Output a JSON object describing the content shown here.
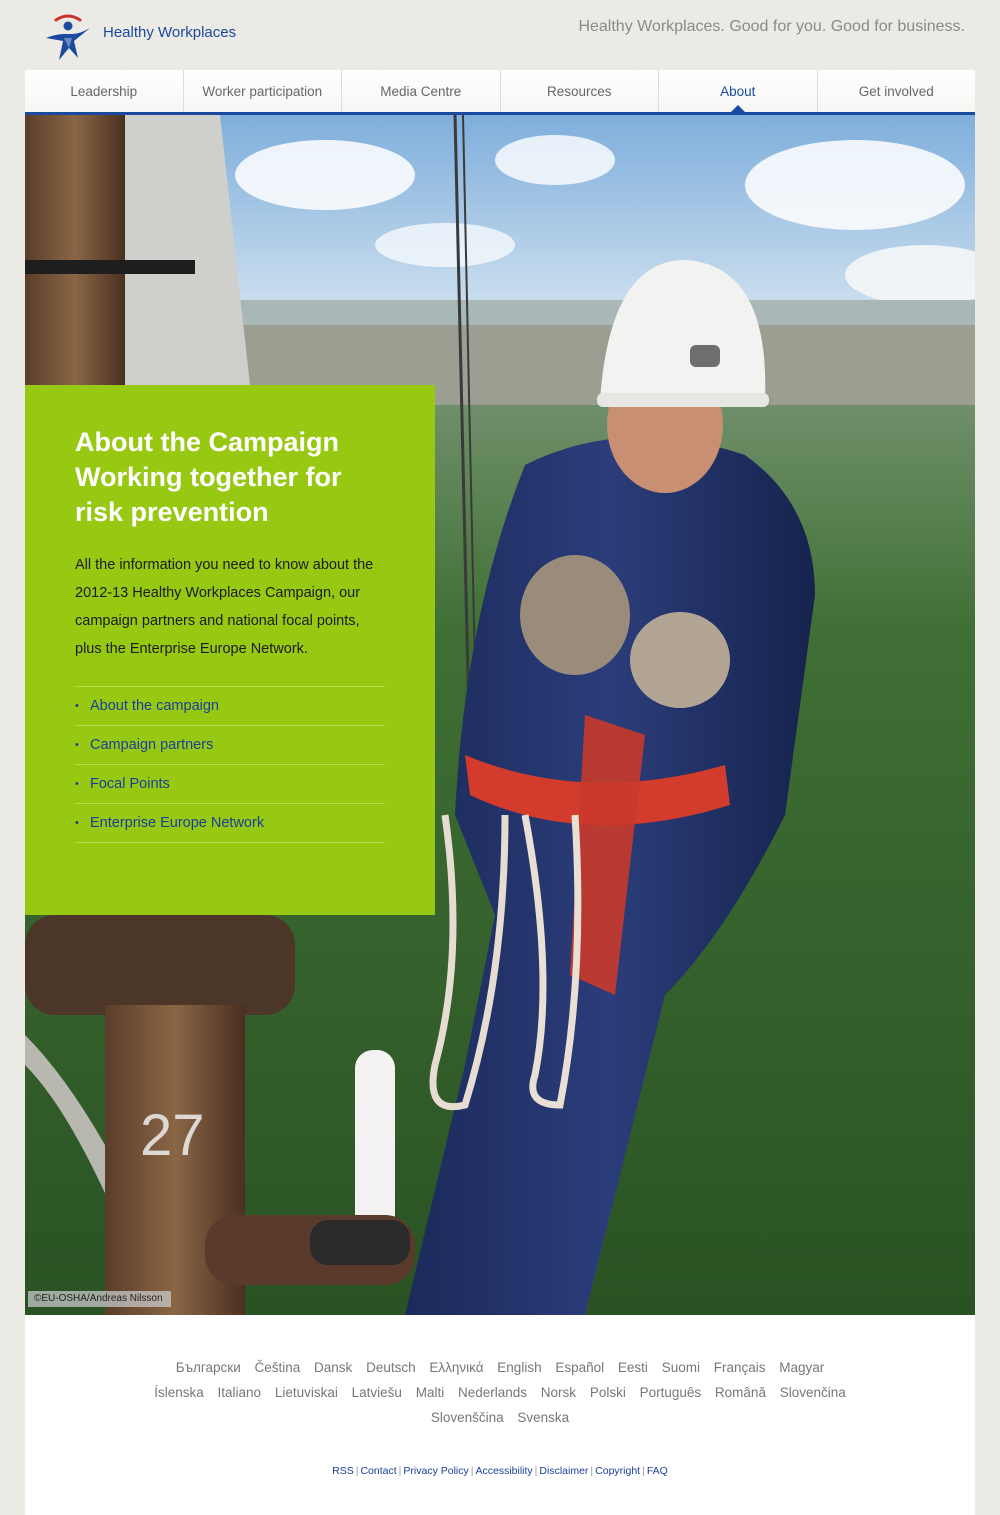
{
  "header": {
    "site_name": "Healthy Workplaces",
    "tagline": "Healthy Workplaces. Good for you. Good for business."
  },
  "nav": {
    "items": [
      {
        "label": "Leadership"
      },
      {
        "label": "Worker participation"
      },
      {
        "label": "Media Centre"
      },
      {
        "label": "Resources"
      },
      {
        "label": "About"
      },
      {
        "label": "Get involved"
      }
    ],
    "active": "About"
  },
  "hero": {
    "photo_credit": "©EU-OSHA/Andreas Nilsson"
  },
  "panel": {
    "title_line1": "About the Campaign",
    "title_line2": "Working together for",
    "title_line3": "risk prevention",
    "description": "All the information you need to know about the 2012-13 Healthy Workplaces Campaign, our campaign partners and national focal points, plus the Enterprise Europe Network.",
    "links": [
      {
        "label": "About the campaign"
      },
      {
        "label": "Campaign partners"
      },
      {
        "label": "Focal Points"
      },
      {
        "label": "Enterprise Europe Network"
      }
    ]
  },
  "footer": {
    "languages": [
      "Български",
      "Čeština",
      "Dansk",
      "Deutsch",
      "Ελληνικά",
      "English",
      "Español",
      "Eesti",
      "Suomi",
      "Français",
      "Magyar",
      "Íslenska",
      "Italiano",
      "Lietuviskai",
      "Latviešu",
      "Malti",
      "Nederlands",
      "Norsk",
      "Polski",
      "Português",
      "Română",
      "Slovenčina",
      "Slovenščina",
      "Svenska"
    ],
    "links": [
      {
        "label": "RSS"
      },
      {
        "label": "Contact"
      },
      {
        "label": "Privacy Policy"
      },
      {
        "label": "Accessibility"
      },
      {
        "label": "Disclaimer"
      },
      {
        "label": "Copyright"
      },
      {
        "label": "FAQ"
      }
    ]
  },
  "colors": {
    "brand_blue": "#1a4aa0",
    "panel_green": "#97c912",
    "page_bg": "#eceae4"
  }
}
